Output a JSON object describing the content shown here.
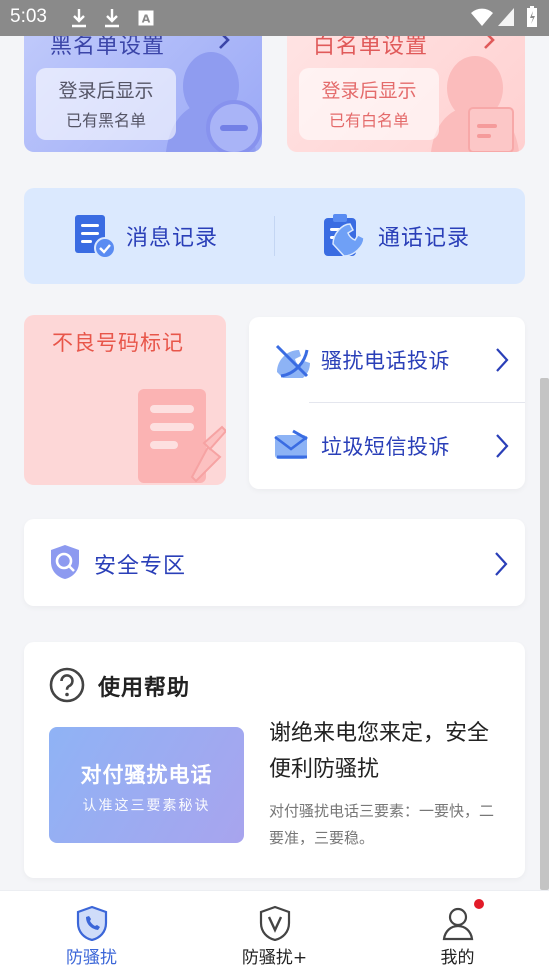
{
  "status_bar": {
    "time": "5:03"
  },
  "blacklist": {
    "title": "黑名单设置",
    "login_text": "登录后显示",
    "sub_text": "已有黑名单"
  },
  "whitelist": {
    "title": "白名单设置",
    "login_text": "登录后显示",
    "sub_text": "已有白名单"
  },
  "records": {
    "message_label": "消息记录",
    "call_label": "通话记录"
  },
  "bad_number": {
    "label": "不良号码标记"
  },
  "complaints": {
    "call_label": "骚扰电话投诉",
    "sms_label": "垃圾短信投诉"
  },
  "safe_zone": {
    "label": "安全专区"
  },
  "help": {
    "title": "使用帮助",
    "banner_title": "对付骚扰电话",
    "banner_sub": "认准这三要素秘诀",
    "headline": "谢绝来电您来定，安全便利防骚扰",
    "desc": "对付骚扰电话三要素：一要快，二要准，三要稳。"
  },
  "tabbar": {
    "tab1": "防骚扰",
    "tab2": "防骚扰+",
    "tab3": "我的"
  },
  "colors": {
    "accent_blue": "#2a3fb8",
    "tab_active": "#3b66d8",
    "badge_red": "#e21b28"
  }
}
